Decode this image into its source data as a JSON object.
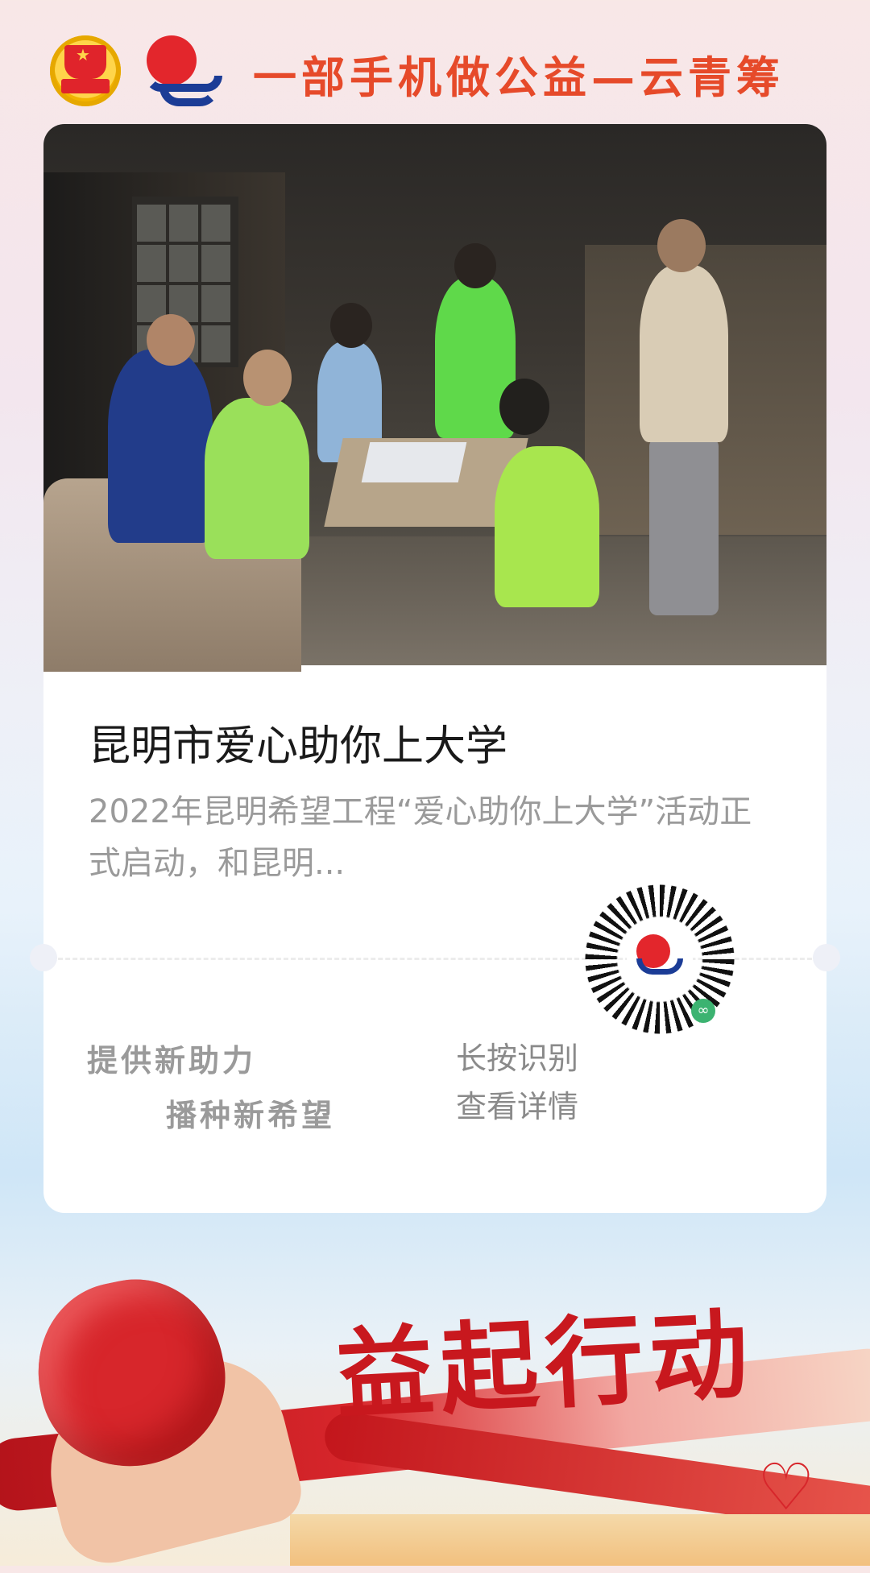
{
  "header": {
    "slogan": "一部手机做公益—云青筹"
  },
  "card": {
    "title": "昆明市爱心助你上大学",
    "description": "2022年昆明希望工程“爱心助你上大学”活动正式启动，和昆明...",
    "tagline_line1": "提供新助力",
    "tagline_line2": "播种新希望",
    "qr_hint_line1": "长按识别",
    "qr_hint_line2": "查看详情"
  },
  "banner": {
    "slogan": "益起行动"
  },
  "colors": {
    "slogan_orange": "#e64a2a",
    "banner_red": "#c8181e",
    "card_bg": "#ffffff",
    "muted_text": "#9a9a9a"
  },
  "icons": {
    "league_logo": "communist-youth-league-emblem-icon",
    "hope_logo": "hope-project-logo-icon",
    "miniprogram_badge": "wechat-mini-program-icon"
  }
}
